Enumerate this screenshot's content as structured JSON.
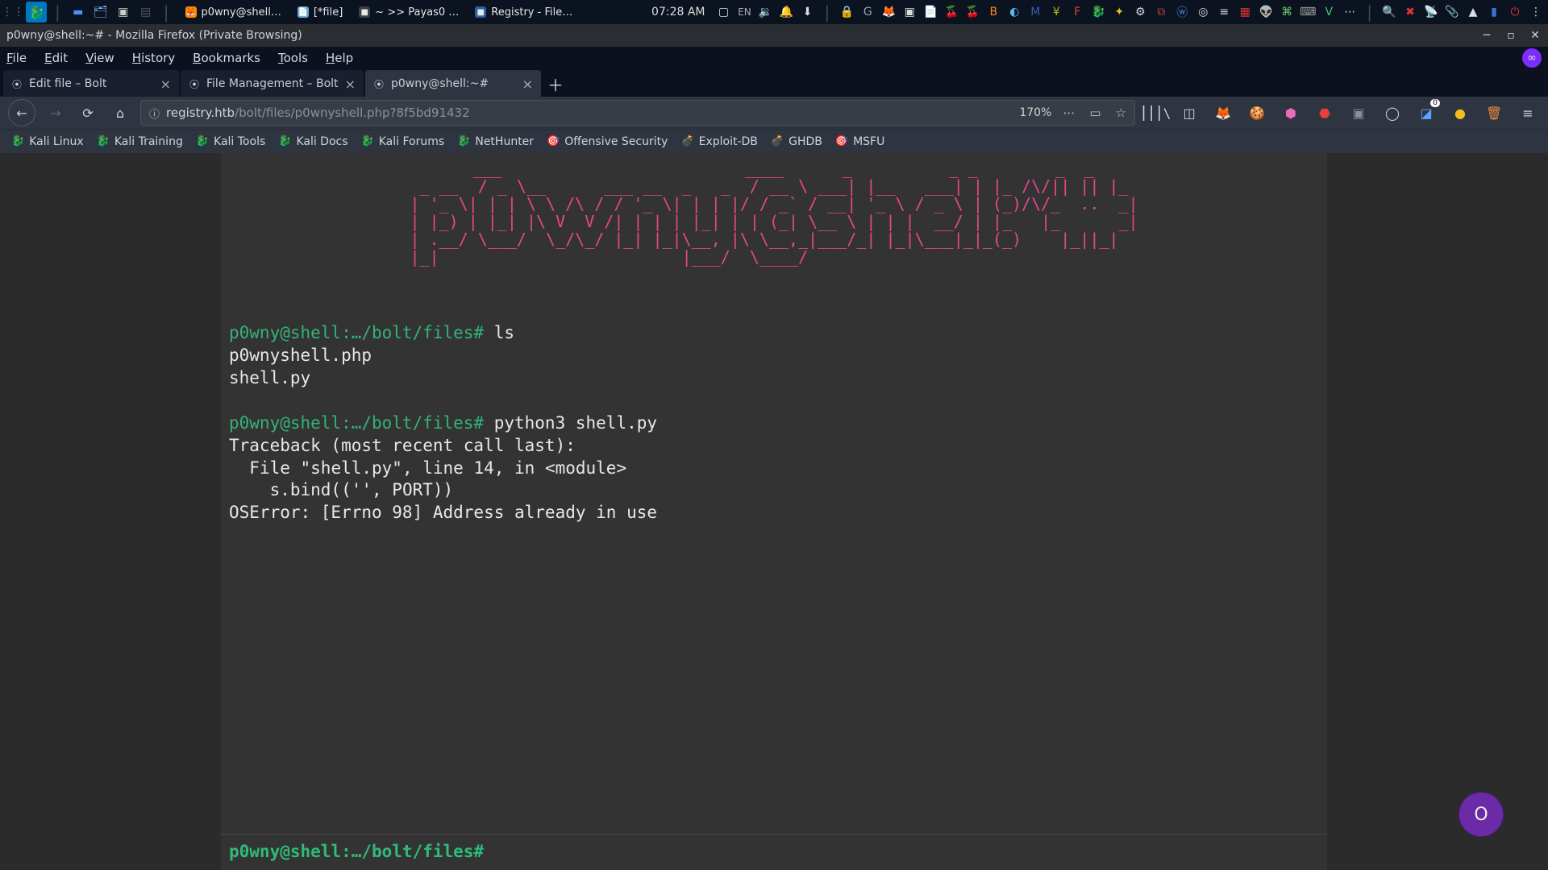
{
  "os_panel": {
    "taskbar": [
      {
        "icon": "🦊",
        "color": "#ff8a00",
        "label": "p0wny@shell…"
      },
      {
        "icon": "📄",
        "color": "#6fa7d4",
        "label": "[*file]"
      },
      {
        "icon": "■",
        "color": "#3a3f4a",
        "label": "~ >> Payas0 …"
      },
      {
        "icon": "■",
        "color": "#2c5fa0",
        "label": "Registry - File…"
      }
    ],
    "clock": "07:28 AM",
    "lang": "EN"
  },
  "window": {
    "title": "p0wny@shell:~# - Mozilla Firefox (Private Browsing)"
  },
  "menubar": [
    "File",
    "Edit",
    "View",
    "History",
    "Bookmarks",
    "Tools",
    "Help"
  ],
  "tabs": [
    {
      "label": "Edit file – Bolt",
      "active": false
    },
    {
      "label": "File Management – Bolt",
      "active": false
    },
    {
      "label": "p0wny@shell:~#",
      "active": true
    }
  ],
  "url": {
    "scheme_info": "ⓘ",
    "host": "registry.htb",
    "path": "/bolt/files/p0wnyshell.php?8f5bd91432",
    "zoom": "170%"
  },
  "bookmarks": [
    {
      "icon": "🐉",
      "label": "Kali Linux"
    },
    {
      "icon": "🐉",
      "label": "Kali Training"
    },
    {
      "icon": "🐉",
      "label": "Kali Tools"
    },
    {
      "icon": "🐉",
      "label": "Kali Docs"
    },
    {
      "icon": "🐉",
      "label": "Kali Forums"
    },
    {
      "icon": "🐉",
      "label": "NetHunter"
    },
    {
      "icon": "🎯",
      "label": "Offensive Security"
    },
    {
      "icon": "💣",
      "label": "Exploit-DB"
    },
    {
      "icon": "💣",
      "label": "GHDB"
    },
    {
      "icon": "🎯",
      "label": "MSFU"
    }
  ],
  "shell": {
    "ascii": "     ___                         ____      _          _ _        _  _   \n _ __  / _ \\__      ___ __  _   _  / __ \\ ___| |__   ___| | |_ /\\/|| || |_ \n| '_ \\| | | \\ \\ /\\ / / '_ \\| | | |/ / _` / __| '_ \\ / _ \\ | (_)/\\/_  ..  _|\n| |_) | |_| |\\ V  V /| | | | |_| | | (_| \\__ \\ | | |  __/ | |_   |_      _|\n| .__/ \\___/  \\_/\\_/ |_| |_|\\__, |\\ \\__,_|___/_| |_|\\___|_|_(_)    |_||_|  \n|_|                         |___/  \\____/                                  ",
    "lines": [
      {
        "prompt": "p0wny@shell:…/bolt/files#",
        "cmd": " ls"
      },
      {
        "out": "p0wnyshell.php"
      },
      {
        "out": "shell.py"
      },
      {
        "out": ""
      },
      {
        "prompt": "p0wny@shell:…/bolt/files#",
        "cmd": " python3 shell.py"
      },
      {
        "out": "Traceback (most recent call last):"
      },
      {
        "out": "  File \"shell.py\", line 14, in <module>"
      },
      {
        "out": "    s.bind(('', PORT))"
      },
      {
        "out": "OSError: [Errno 98] Address already in use"
      }
    ],
    "input_prompt": "p0wny@shell:…/bolt/files#"
  },
  "floating_badge": "O"
}
